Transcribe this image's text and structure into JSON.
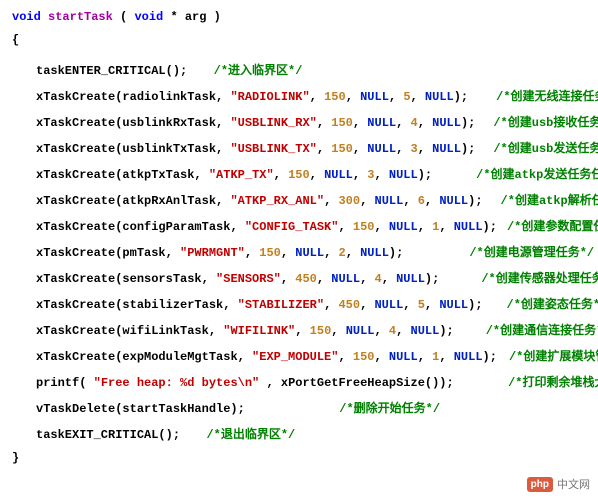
{
  "sig": {
    "ret": "void",
    "name": "startTask",
    "argtype": "void",
    "argstar": "*",
    "argname": "arg"
  },
  "braces": {
    "open": "{",
    "close": "}"
  },
  "enter": {
    "call": "taskENTER_CRITICAL();",
    "cmt": "/*进入临界区*/"
  },
  "tasks": [
    {
      "fn": "xTaskCreate(",
      "t": "radiolinkTask, ",
      "s": "\"RADIOLINK\"",
      "a": ", ",
      "n1": "150",
      "b": ", ",
      "nu1": "NULL",
      "c": ", ",
      "n2": "5",
      "d": ", ",
      "nu2": "NULL",
      "e": ");",
      "cmt": "/*创建无线连接任务*/"
    },
    {
      "fn": "xTaskCreate(",
      "t": "usblinkRxTask, ",
      "s": "\"USBLINK_RX\"",
      "a": ", ",
      "n1": "150",
      "b": ", ",
      "nu1": "NULL",
      "c": ", ",
      "n2": "4",
      "d": ", ",
      "nu2": "NULL",
      "e": ");",
      "cmt": "/*创建usb接收任务*/"
    },
    {
      "fn": "xTaskCreate(",
      "t": "usblinkTxTask, ",
      "s": "\"USBLINK_TX\"",
      "a": ", ",
      "n1": "150",
      "b": ", ",
      "nu1": "NULL",
      "c": ", ",
      "n2": "3",
      "d": ", ",
      "nu2": "NULL",
      "e": ");",
      "cmt": "/*创建usb发送任务*/"
    },
    {
      "fn": "xTaskCreate(",
      "t": "atkpTxTask, ",
      "s": "\"ATKP_TX\"",
      "a": ", ",
      "n1": "150",
      "b": ", ",
      "nu1": "NULL",
      "c": ", ",
      "n2": "3",
      "d": ", ",
      "nu2": "NULL",
      "e": ");",
      "cmt": "/*创建atkp发送任务任务*/"
    },
    {
      "fn": "xTaskCreate(",
      "t": "atkpRxAnlTask, ",
      "s": "\"ATKP_RX_ANL\"",
      "a": ", ",
      "n1": "300",
      "b": ", ",
      "nu1": "NULL",
      "c": ", ",
      "n2": "6",
      "d": ", ",
      "nu2": "NULL",
      "e": ");",
      "cmt": "/*创建atkp解析任务*/"
    },
    {
      "fn": "xTaskCreate(",
      "t": "configParamTask, ",
      "s": "\"CONFIG_TASK\"",
      "a": ", ",
      "n1": "150",
      "b": ", ",
      "nu1": "NULL",
      "c": ", ",
      "n2": "1",
      "d": ", ",
      "nu2": "NULL",
      "e": ");",
      "cmt": "/*创建参数配置任务*/"
    },
    {
      "fn": "xTaskCreate(",
      "t": "pmTask, ",
      "s": "\"PWRMGNT\"",
      "a": ", ",
      "n1": "150",
      "b": ", ",
      "nu1": "NULL",
      "c": ", ",
      "n2": "2",
      "d": ", ",
      "nu2": "NULL",
      "e": ");",
      "cmt": "/*创建电源管理任务*/"
    },
    {
      "fn": "xTaskCreate(",
      "t": "sensorsTask, ",
      "s": "\"SENSORS\"",
      "a": ", ",
      "n1": "450",
      "b": ", ",
      "nu1": "NULL",
      "c": ", ",
      "n2": "4",
      "d": ", ",
      "nu2": "NULL",
      "e": ");",
      "cmt": "/*创建传感器处理任务*/"
    },
    {
      "fn": "xTaskCreate(",
      "t": "stabilizerTask, ",
      "s": "\"STABILIZER\"",
      "a": ", ",
      "n1": "450",
      "b": ", ",
      "nu1": "NULL",
      "c": ", ",
      "n2": "5",
      "d": ", ",
      "nu2": "NULL",
      "e": ");",
      "cmt": "/*创建姿态任务*/"
    },
    {
      "fn": "xTaskCreate(",
      "t": "wifiLinkTask, ",
      "s": "\"WIFILINK\"",
      "a": ", ",
      "n1": "150",
      "b": ", ",
      "nu1": "NULL",
      "c": ", ",
      "n2": "4",
      "d": ", ",
      "nu2": "NULL",
      "e": ");",
      "cmt": "/*创建通信连接任务*/"
    },
    {
      "fn": "xTaskCreate(",
      "t": "expModuleMgtTask, ",
      "s": "\"EXP_MODULE\"",
      "a": ", ",
      "n1": "150",
      "b": ", ",
      "nu1": "NULL",
      "c": ", ",
      "n2": "1",
      "d": ", ",
      "nu2": "NULL",
      "e": ");",
      "cmt": "/*创建扩展模块管理任务*/"
    }
  ],
  "printf": {
    "open": "printf(",
    "str": "\"Free heap: %d bytes\\n\"",
    "mid": ", xPortGetFreeHeapSize());",
    "cmt": "/*打印剩余堆栈大小*/"
  },
  "del": {
    "call": "vTaskDelete(startTaskHandle);",
    "cmt": "/*删除开始任务*/"
  },
  "exit": {
    "call": "taskEXIT_CRITICAL();",
    "cmt": "/*退出临界区*/"
  },
  "gaps": [
    28,
    18,
    18,
    44,
    18,
    10,
    66,
    42,
    24,
    32,
    12,
    40,
    80
  ],
  "watermark": {
    "icon": "php",
    "text": "中文网"
  }
}
